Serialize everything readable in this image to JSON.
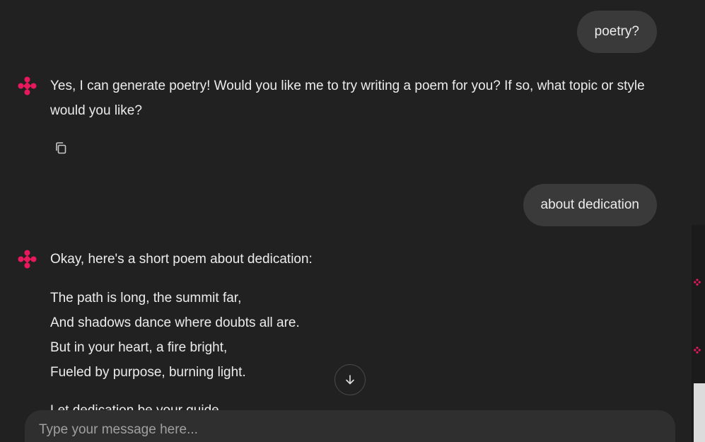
{
  "conversation": {
    "messages": [
      {
        "role": "user",
        "text": "poetry?"
      },
      {
        "role": "assistant",
        "text": "Yes, I can generate poetry! Would you like me to try writing a poem for you? If so, what topic or style would you like?"
      },
      {
        "role": "user",
        "text": "about dedication"
      },
      {
        "role": "assistant",
        "intro": "Okay, here's a short poem about dedication:",
        "poem_lines": [
          "The path is long, the summit far,",
          "And shadows dance where doubts all are.",
          "But in your heart, a fire bright,",
          "Fueled by purpose, burning light."
        ],
        "partial_next_line": "Let dedication be your guide"
      }
    ]
  },
  "icons": {
    "assistant_avatar": "gemini-sparkle-icon",
    "copy": "copy-icon",
    "scroll_down": "arrow-down-icon"
  },
  "composer": {
    "placeholder": "Type your message here..."
  },
  "colors": {
    "background": "#212121",
    "user_bubble": "#3a3a3a",
    "accent": "#e8185c",
    "input_bar": "#2f2f2f"
  }
}
